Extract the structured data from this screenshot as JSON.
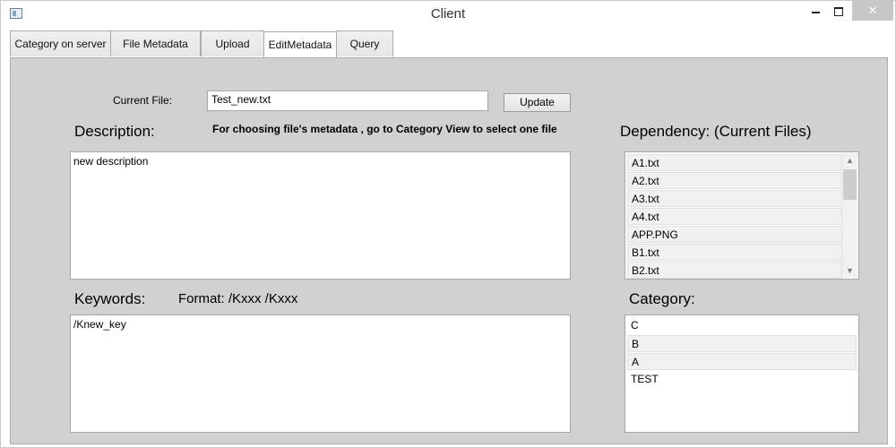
{
  "window": {
    "title": "Client",
    "close_glyph": "✕",
    "colors": {
      "tab_panel_bg": "#d1d1d1",
      "close_button_bg": "#c7c7c7"
    }
  },
  "tabs": [
    {
      "label": "Category on server"
    },
    {
      "label": "File Metadata"
    },
    {
      "label": "Upload"
    },
    {
      "label": "EditMetadata",
      "selected": true
    },
    {
      "label": "Query"
    }
  ],
  "edit": {
    "current_file_label": "Current File:",
    "current_file_value": "Test_new.txt",
    "update_button": "Update",
    "description_label": "Description:",
    "instruction_text": "For choosing file's metadata , go to Category View to select one file",
    "description_value": "new description",
    "keywords_label": "Keywords:",
    "format_text": "Format:  /Kxxx /Kxxx",
    "keywords_value": "/Knew_key",
    "dependency_label": "Dependency: (Current Files)",
    "dependency_items": [
      "A1.txt",
      "A2.txt",
      "A3.txt",
      "A4.txt",
      "APP.PNG",
      "B1.txt",
      "B2.txt"
    ],
    "category_label": "Category:",
    "category_items": [
      "C",
      "B",
      "A",
      "TEST"
    ]
  }
}
